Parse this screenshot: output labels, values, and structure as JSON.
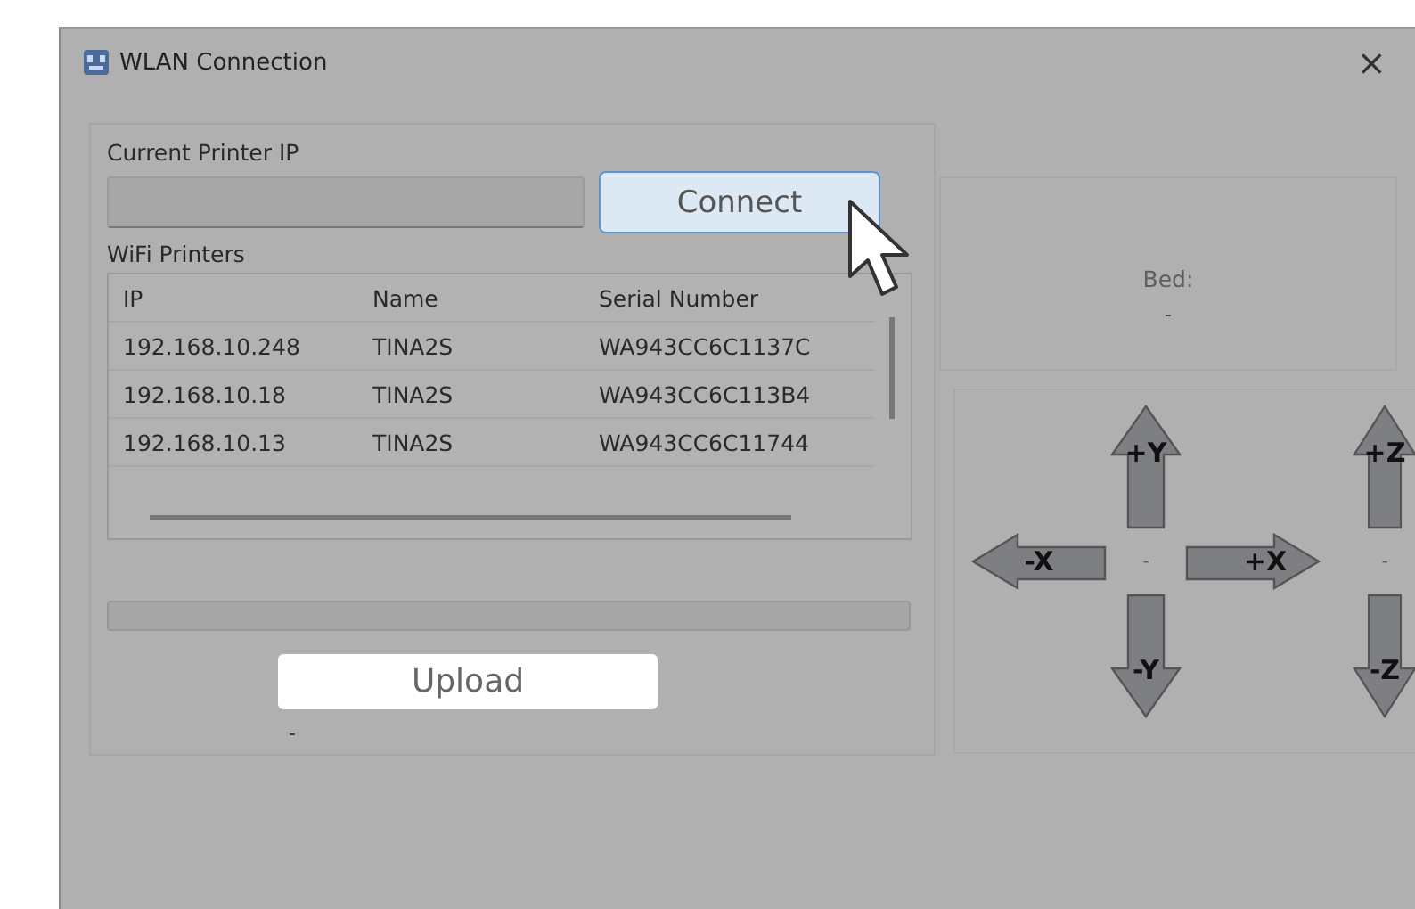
{
  "window": {
    "title": "WLAN Connection",
    "close_button": "×"
  },
  "printer_panel": {
    "ip_label": "Current Printer IP",
    "connect_button": "Connect",
    "list_label": "WiFi Printers",
    "table": {
      "columns": [
        "IP",
        "Name",
        "Serial Number"
      ],
      "rows": [
        [
          "192.168.10.248",
          "TINA2S",
          "WA943CC6C1137C"
        ],
        [
          "192.168.10.18",
          "TINA2S",
          "WA943CC6C113B4"
        ],
        [
          "192.168.10.13",
          "TINA2S",
          "WA943CC6C11744"
        ]
      ]
    },
    "progress": {
      "level": 0
    },
    "upload_button": "Upload",
    "status": "-"
  },
  "temperature": {
    "label": "Bed:",
    "value": "-"
  },
  "jog": {
    "xy_buttons": [
      {
        "label": "+Y",
        "kind": "up"
      },
      {
        "label": "-X",
        "kind": "left"
      },
      {
        "label": "+X",
        "kind": "right"
      },
      {
        "label": "-Y",
        "kind": "down"
      }
    ],
    "z_buttons": [
      {
        "label": "+Z",
        "kind": "up"
      },
      {
        "label": "-Z",
        "kind": "down"
      }
    ],
    "xy_reading": "-",
    "z_reading": "-"
  }
}
